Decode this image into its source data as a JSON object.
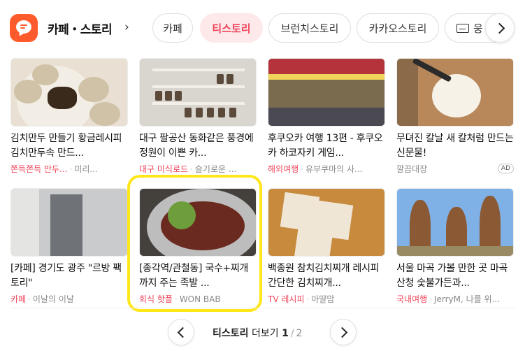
{
  "header": {
    "brand": "카페・스토리",
    "brand_arrow": "›",
    "tabs": [
      {
        "label": "카페",
        "active": false
      },
      {
        "label": "티스토리",
        "active": true
      },
      {
        "label": "브런치스토리",
        "active": false
      },
      {
        "label": "카카오스토리",
        "active": false
      },
      {
        "label": "웅",
        "active": false
      }
    ]
  },
  "cards": [
    {
      "title": "김치만두 만들기 황금레시피 김치만두속 만드...",
      "category": "쫀득쫀득 만두...",
      "author": "미리...",
      "ad": ""
    },
    {
      "title": "대구 팔공산 동화같은 풍경에 정원이 이쁜 카...",
      "category": "대구 미식로드",
      "author": "슬기로운 ...",
      "ad": ""
    },
    {
      "title": "후쿠오카 여행 13편 - 후쿠오카 하코자키 게임...",
      "category": "해외여행",
      "author": "유부쿠마의 사...",
      "ad": ""
    },
    {
      "title": "무뎌진 칼날 새 칼처럼 만드는 신문물!",
      "category": "",
      "author": "깔끔대장",
      "ad": "AD"
    },
    {
      "title": "[카페] 경기도 광주 \"르방 팩토리\"",
      "category": "카페",
      "author": "이날의 이날",
      "ad": ""
    },
    {
      "title": "[종각역/관철동] 국수+찌개까지 주는 족발 ...",
      "category": "회식 핫플",
      "author": "WON BAB",
      "ad": ""
    },
    {
      "title": "백종원 참치김치찌개 레시피 간단한 김치찌개...",
      "category": "TV 레시피",
      "author": "아땰맘",
      "ad": ""
    },
    {
      "title": "서울 마곡 가볼 만한 곳 마곡 산청 숯불가든과...",
      "category": "국내여행",
      "author": "JerryM, 나를 위...",
      "ad": ""
    }
  ],
  "pagination": {
    "label_bold": "티스토리",
    "label": "더보기",
    "current": "1",
    "separator": "/",
    "total": "2"
  },
  "colors": {
    "accent": "#f0455b",
    "logo": "#ff5a2c",
    "highlight": "#ffe71a"
  }
}
